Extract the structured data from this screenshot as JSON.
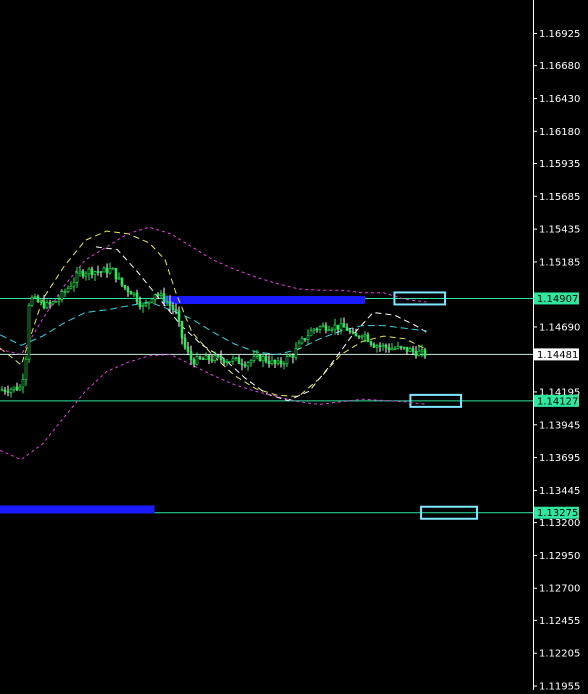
{
  "chart_data": {
    "type": "candlestick",
    "y_axis": {
      "ylim": [
        1.11925,
        1.1718
      ],
      "tick_labels": [
        "1.16925",
        "1.16680",
        "1.16430",
        "1.16180",
        "1.15935",
        "1.15685",
        "1.15435",
        "1.15185",
        "1.14690",
        "1.14195",
        "1.13945",
        "1.13695",
        "1.13445",
        "1.13200",
        "1.12950",
        "1.12700",
        "1.12455",
        "1.12205",
        "1.11955"
      ]
    },
    "price_tags": [
      {
        "label": "1.14907",
        "value": 1.14907,
        "color": "#2ee8a0"
      },
      {
        "label": "1.14481",
        "value": 1.14481,
        "color": "#ffffff"
      },
      {
        "label": "1.14127",
        "value": 1.14127,
        "color": "#2ee8a0"
      },
      {
        "label": "1.13275",
        "value": 1.13275,
        "color": "#2ee8a0"
      }
    ],
    "horizontal_lines": [
      {
        "value": 1.14907,
        "color": "#2ee8a0"
      },
      {
        "value": 1.14481,
        "color": "#c8f0e0"
      },
      {
        "value": 1.14127,
        "color": "#2ee8a0"
      },
      {
        "value": 1.13275,
        "color": "#2ee8a0"
      }
    ],
    "zones": [
      {
        "type": "bar",
        "value": 1.14895,
        "x_from": 0.305,
        "x_to": 0.685,
        "color": "#1a1aff"
      },
      {
        "type": "bar",
        "value": 1.133,
        "x_from": 0.0,
        "x_to": 0.29,
        "color": "#1a1aff"
      },
      {
        "type": "box",
        "value": 1.14907,
        "x_from": 0.74,
        "x_to": 0.835,
        "color": "#7ee8ff"
      },
      {
        "type": "box",
        "value": 1.14127,
        "x_from": 0.77,
        "x_to": 0.865,
        "color": "#7ee8ff"
      },
      {
        "type": "box",
        "value": 1.13275,
        "x_from": 0.79,
        "x_to": 0.895,
        "color": "#7ee8ff"
      }
    ],
    "series": [
      {
        "role": "price",
        "color": "#2ee85a",
        "points": [
          [
            0,
            1.1421
          ],
          [
            0.04,
            1.1423
          ],
          [
            0.05,
            1.145
          ],
          [
            0.055,
            1.1492
          ],
          [
            0.07,
            1.1488
          ],
          [
            0.09,
            1.1485
          ],
          [
            0.11,
            1.149
          ],
          [
            0.13,
            1.15
          ],
          [
            0.15,
            1.151
          ],
          [
            0.17,
            1.1512
          ],
          [
            0.19,
            1.1511
          ],
          [
            0.21,
            1.1513
          ],
          [
            0.23,
            1.15
          ],
          [
            0.25,
            1.1495
          ],
          [
            0.27,
            1.1483
          ],
          [
            0.29,
            1.1495
          ],
          [
            0.31,
            1.149
          ],
          [
            0.33,
            1.148
          ],
          [
            0.345,
            1.1455
          ],
          [
            0.36,
            1.1443
          ],
          [
            0.38,
            1.1444
          ],
          [
            0.4,
            1.1445
          ],
          [
            0.43,
            1.1444
          ],
          [
            0.46,
            1.1442
          ],
          [
            0.49,
            1.1446
          ],
          [
            0.52,
            1.144
          ],
          [
            0.55,
            1.1448
          ],
          [
            0.57,
            1.146
          ],
          [
            0.59,
            1.1468
          ],
          [
            0.62,
            1.147
          ],
          [
            0.65,
            1.1468
          ],
          [
            0.665,
            1.146
          ],
          [
            0.68,
            1.1465
          ],
          [
            0.7,
            1.1456
          ],
          [
            0.73,
            1.1453
          ],
          [
            0.76,
            1.1452
          ],
          [
            0.78,
            1.145
          ],
          [
            0.8,
            1.1448
          ]
        ]
      },
      {
        "role": "ma_fast",
        "color": "#e8e85a",
        "dash": "6,4",
        "points": [
          [
            0,
            1.1453
          ],
          [
            0.04,
            1.144
          ],
          [
            0.08,
            1.149
          ],
          [
            0.12,
            1.1515
          ],
          [
            0.16,
            1.1535
          ],
          [
            0.2,
            1.1542
          ],
          [
            0.24,
            1.154
          ],
          [
            0.28,
            1.1533
          ],
          [
            0.31,
            1.152
          ],
          [
            0.33,
            1.1495
          ],
          [
            0.36,
            1.1465
          ],
          [
            0.4,
            1.1447
          ],
          [
            0.44,
            1.1432
          ],
          [
            0.48,
            1.1422
          ],
          [
            0.52,
            1.1417
          ],
          [
            0.56,
            1.1416
          ],
          [
            0.6,
            1.143
          ],
          [
            0.64,
            1.1448
          ],
          [
            0.68,
            1.1458
          ],
          [
            0.72,
            1.1462
          ],
          [
            0.76,
            1.146
          ],
          [
            0.8,
            1.1452
          ]
        ]
      },
      {
        "role": "ma_white",
        "color": "#ffffff",
        "dash": "6,4",
        "points": [
          [
            0.18,
            1.153
          ],
          [
            0.22,
            1.1528
          ],
          [
            0.26,
            1.151
          ],
          [
            0.3,
            1.149
          ],
          [
            0.34,
            1.147
          ],
          [
            0.38,
            1.1455
          ],
          [
            0.42,
            1.1445
          ],
          [
            0.46,
            1.143
          ],
          [
            0.5,
            1.1418
          ],
          [
            0.54,
            1.1413
          ],
          [
            0.58,
            1.142
          ],
          [
            0.62,
            1.144
          ],
          [
            0.66,
            1.1462
          ],
          [
            0.7,
            1.148
          ],
          [
            0.74,
            1.1478
          ],
          [
            0.78,
            1.147
          ],
          [
            0.8,
            1.1465
          ]
        ]
      },
      {
        "role": "ma_cyan",
        "color": "#3ad0e0",
        "dash": "7,4",
        "points": [
          [
            0,
            1.1463
          ],
          [
            0.04,
            1.1455
          ],
          [
            0.08,
            1.1462
          ],
          [
            0.12,
            1.1472
          ],
          [
            0.16,
            1.148
          ],
          [
            0.2,
            1.1482
          ],
          [
            0.24,
            1.1485
          ],
          [
            0.28,
            1.1488
          ],
          [
            0.32,
            1.1482
          ],
          [
            0.36,
            1.1475
          ],
          [
            0.4,
            1.1465
          ],
          [
            0.44,
            1.1456
          ],
          [
            0.48,
            1.145
          ],
          [
            0.52,
            1.1448
          ],
          [
            0.56,
            1.1452
          ],
          [
            0.6,
            1.146
          ],
          [
            0.64,
            1.1466
          ],
          [
            0.68,
            1.147
          ],
          [
            0.72,
            1.147
          ],
          [
            0.76,
            1.1468
          ],
          [
            0.8,
            1.1466
          ]
        ]
      },
      {
        "role": "band_upper",
        "color": "#e040e0",
        "dash": "3,3",
        "points": [
          [
            0,
            1.1452
          ],
          [
            0.04,
            1.1448
          ],
          [
            0.08,
            1.1475
          ],
          [
            0.12,
            1.15
          ],
          [
            0.16,
            1.152
          ],
          [
            0.2,
            1.153
          ],
          [
            0.24,
            1.154
          ],
          [
            0.28,
            1.1545
          ],
          [
            0.32,
            1.154
          ],
          [
            0.36,
            1.153
          ],
          [
            0.4,
            1.152
          ],
          [
            0.44,
            1.1513
          ],
          [
            0.48,
            1.1507
          ],
          [
            0.52,
            1.1502
          ],
          [
            0.56,
            1.1498
          ],
          [
            0.6,
            1.1497
          ],
          [
            0.64,
            1.1497
          ],
          [
            0.68,
            1.1495
          ],
          [
            0.72,
            1.1495
          ],
          [
            0.76,
            1.149
          ],
          [
            0.8,
            1.1488
          ]
        ]
      },
      {
        "role": "band_lower",
        "color": "#e040e0",
        "dash": "3,3",
        "points": [
          [
            0,
            1.1375
          ],
          [
            0.04,
            1.1368
          ],
          [
            0.08,
            1.138
          ],
          [
            0.12,
            1.14
          ],
          [
            0.16,
            1.142
          ],
          [
            0.2,
            1.1435
          ],
          [
            0.24,
            1.1442
          ],
          [
            0.28,
            1.1447
          ],
          [
            0.32,
            1.1448
          ],
          [
            0.36,
            1.144
          ],
          [
            0.4,
            1.1432
          ],
          [
            0.44,
            1.1425
          ],
          [
            0.48,
            1.142
          ],
          [
            0.52,
            1.1416
          ],
          [
            0.56,
            1.1412
          ],
          [
            0.6,
            1.141
          ],
          [
            0.64,
            1.1412
          ],
          [
            0.68,
            1.1414
          ],
          [
            0.72,
            1.1413
          ],
          [
            0.76,
            1.1412
          ],
          [
            0.8,
            1.141
          ]
        ]
      }
    ]
  }
}
